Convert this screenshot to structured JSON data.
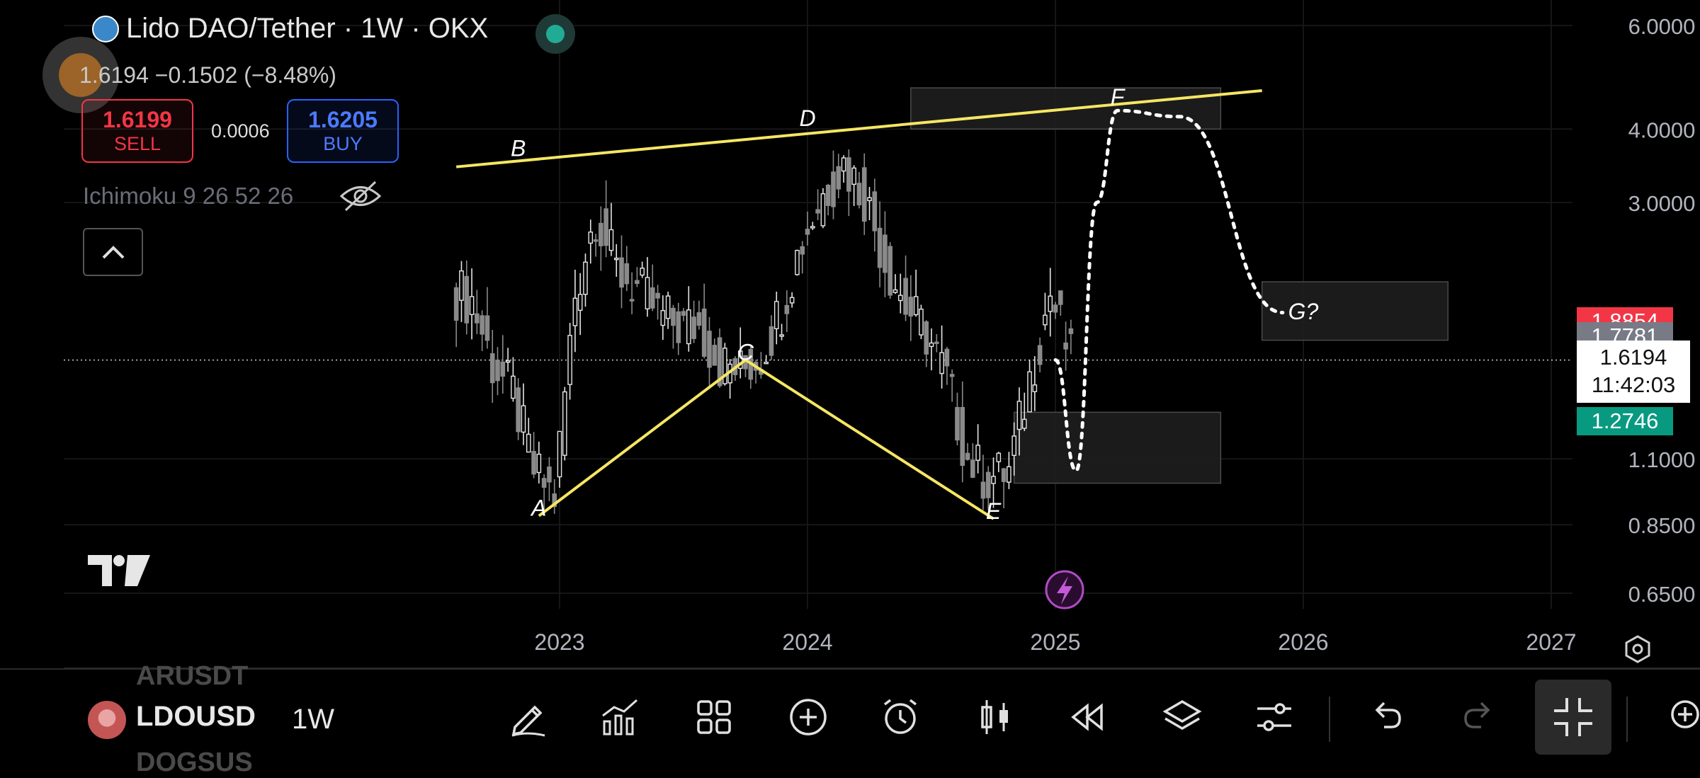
{
  "header": {
    "title": "Lido DAO/Tether · 1W · OKX",
    "ohlc": "1.6194  −0.1502 (−8.48%)",
    "sell_price": "1.6199",
    "sell_label": "SELL",
    "spread": "0.0006",
    "buy_price": "1.6205",
    "buy_label": "BUY",
    "indicator": "Ichimoku 9 26 52 26"
  },
  "price_axis": {
    "ticks": [
      {
        "label": "6.0000",
        "value": 6.0
      },
      {
        "label": "4.0000",
        "value": 4.0
      },
      {
        "label": "3.0000",
        "value": 3.0
      },
      {
        "label": "1.1000",
        "value": 1.1
      },
      {
        "label": "0.8500",
        "value": 0.85
      },
      {
        "label": "0.6500",
        "value": 0.65
      }
    ],
    "tags": [
      {
        "label": "1.8854",
        "value": 1.8854,
        "color": "#f23645"
      },
      {
        "label": "1.7781",
        "value": 1.7781,
        "color": "#787b86"
      },
      {
        "label": "1.2746",
        "value": 1.2746,
        "color": "#089981"
      }
    ],
    "current_price": "1.6194",
    "countdown": "11:42:03"
  },
  "time_axis": {
    "labels": [
      "2023",
      "2024",
      "2025",
      "2026",
      "2027"
    ]
  },
  "chart_data": {
    "type": "candlestick",
    "scale": "log",
    "interval": "1W",
    "ylim": [
      0.58,
      7.0
    ],
    "x": [
      "2022-08",
      "2022-09",
      "2022-10",
      "2022-11",
      "2022-12",
      "2023-01",
      "2023-02",
      "2023-03",
      "2023-04",
      "2023-05",
      "2023-06",
      "2023-07",
      "2023-08",
      "2023-09",
      "2023-10",
      "2023-11",
      "2023-12",
      "2024-01",
      "2024-02",
      "2024-03",
      "2024-04",
      "2024-05",
      "2024-06",
      "2024-07",
      "2024-08",
      "2024-09",
      "2024-10",
      "2024-11",
      "2024-12",
      "2025-01"
    ],
    "close": [
      2.05,
      1.6,
      1.42,
      1.05,
      0.95,
      2.1,
      2.9,
      2.3,
      2.15,
      1.95,
      1.85,
      1.85,
      1.6,
      1.55,
      1.65,
      2.0,
      2.6,
      3.1,
      3.5,
      3.1,
      2.4,
      2.0,
      1.8,
      1.5,
      1.1,
      1.02,
      1.05,
      1.5,
      2.1,
      1.62
    ],
    "annotations": {
      "wave_labels": [
        {
          "text": "A",
          "date": "2022-12",
          "price": 0.88
        },
        {
          "text": "B",
          "date": "2022-11",
          "price": 3.6
        },
        {
          "text": "C",
          "date": "2023-10",
          "price": 1.62
        },
        {
          "text": "D",
          "date": "2024-01",
          "price": 4.05
        },
        {
          "text": "E",
          "date": "2024-10",
          "price": 0.87
        },
        {
          "text": "F",
          "date": "2025-04",
          "price": 4.4
        },
        {
          "text": "G?",
          "date": "2026-01",
          "price": 1.9
        }
      ],
      "trendlines": [
        {
          "from": [
            "2022-08",
            3.45
          ],
          "to": [
            "2025-11",
            4.65
          ],
          "color": "#f5e663"
        },
        {
          "from": [
            "2022-12",
            0.88
          ],
          "to": [
            "2023-10",
            1.62
          ],
          "color": "#f5e663"
        },
        {
          "from": [
            "2023-10",
            1.62
          ],
          "to": [
            "2024-10",
            0.87
          ],
          "color": "#f5e663"
        }
      ],
      "zones": [
        {
          "date_from": "2024-06",
          "date_to": "2025-09",
          "price_low": 4.0,
          "price_high": 4.7
        },
        {
          "date_from": "2025-11",
          "date_to": "2026-08",
          "price_low": 1.75,
          "price_high": 2.2
        },
        {
          "date_from": "2024-11",
          "date_to": "2025-09",
          "price_low": 1.0,
          "price_high": 1.32
        }
      ],
      "projection_path": [
        [
          "2025-01",
          1.62
        ],
        [
          "2025-02",
          1.05
        ],
        [
          "2025-03",
          3.0
        ],
        [
          "2025-04",
          4.3
        ],
        [
          "2025-07",
          4.2
        ],
        [
          "2025-12",
          1.95
        ]
      ]
    }
  },
  "bottom_bar": {
    "symbol_prev": "ARUSDT",
    "symbol_current": "LDOUSD",
    "symbol_next": "DOGSUS",
    "interval": "1W"
  },
  "colors": {
    "background": "#000000",
    "up": "#e6e6e6",
    "down": "#8a8a8a",
    "annotation": "#f5e663",
    "zone_fill": "#1e1e1e",
    "sell": "#f23645",
    "buy": "#2962ff"
  }
}
